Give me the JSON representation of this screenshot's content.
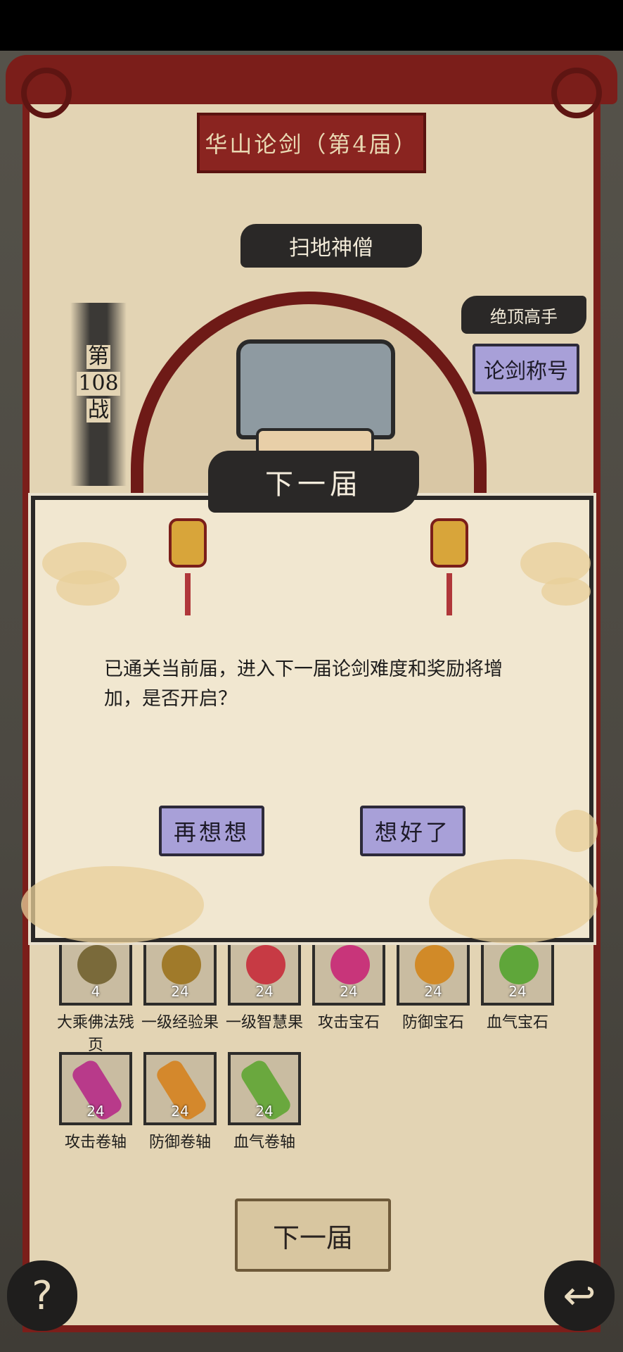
{
  "header": {
    "title": "华山论剑（第4届）"
  },
  "opponent": {
    "name": "扫地神僧",
    "rank_title": "绝顶高手",
    "title_button": "论剑称号",
    "battle_label_top": "第",
    "battle_number": "108",
    "battle_label_bottom": "战"
  },
  "dialog": {
    "header": "下一届",
    "message": "已通关当前届，进入下一届论剑难度和奖励将增加，是否开启？",
    "cancel_label": "再想想",
    "confirm_label": "想好了"
  },
  "rewards": [
    {
      "label": "大乘佛法残页",
      "count": "4",
      "icon": "scripture-icon",
      "color": "#7a6a3a"
    },
    {
      "label": "一级经验果",
      "count": "24",
      "icon": "fruit-icon",
      "color": "#a07a2a"
    },
    {
      "label": "一级智慧果",
      "count": "24",
      "icon": "radish-icon",
      "color": "#c73a44"
    },
    {
      "label": "攻击宝石",
      "count": "24",
      "icon": "gem-icon",
      "color": "#c8357a"
    },
    {
      "label": "防御宝石",
      "count": "24",
      "icon": "gem-icon",
      "color": "#d18a28"
    },
    {
      "label": "血气宝石",
      "count": "24",
      "icon": "gem-icon",
      "color": "#5fa63a"
    },
    {
      "label": "攻击卷轴",
      "count": "24",
      "icon": "scroll-icon",
      "color": "#b83a8a"
    },
    {
      "label": "防御卷轴",
      "count": "24",
      "icon": "scroll-icon",
      "color": "#d4882c"
    },
    {
      "label": "血气卷轴",
      "count": "24",
      "icon": "scroll-icon",
      "color": "#6aa83e"
    }
  ],
  "footer": {
    "next_button": "下一届",
    "help_icon": "?",
    "back_icon": "↩"
  }
}
